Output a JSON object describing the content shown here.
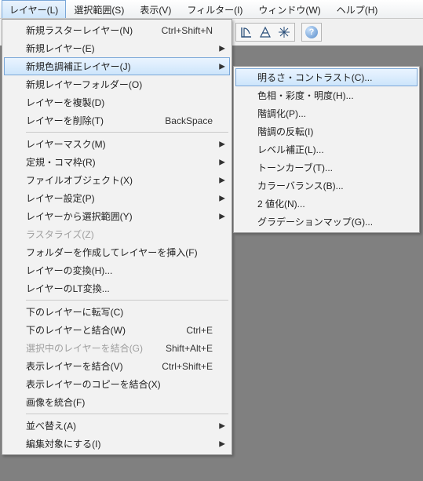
{
  "menubar": {
    "items": [
      {
        "label": "レイヤー(L)"
      },
      {
        "label": "選択範囲(S)"
      },
      {
        "label": "表示(V)"
      },
      {
        "label": "フィルター(I)"
      },
      {
        "label": "ウィンドウ(W)"
      },
      {
        "label": "ヘルプ(H)"
      }
    ]
  },
  "help_label": "?",
  "menu_main": {
    "groups": [
      [
        {
          "label": "新規ラスターレイヤー(N)",
          "accel": "Ctrl+Shift+N"
        },
        {
          "label": "新規レイヤー(E)",
          "submenu": true
        },
        {
          "label": "新規色調補正レイヤー(J)",
          "submenu": true,
          "highlight": true
        },
        {
          "label": "新規レイヤーフォルダー(O)"
        },
        {
          "label": "レイヤーを複製(D)"
        },
        {
          "label": "レイヤーを削除(T)",
          "accel": "BackSpace"
        }
      ],
      [
        {
          "label": "レイヤーマスク(M)",
          "submenu": true
        },
        {
          "label": "定規・コマ枠(R)",
          "submenu": true
        },
        {
          "label": "ファイルオブジェクト(X)",
          "submenu": true
        },
        {
          "label": "レイヤー設定(P)",
          "submenu": true
        },
        {
          "label": "レイヤーから選択範囲(Y)",
          "submenu": true
        },
        {
          "label": "ラスタライズ(Z)",
          "disabled": true
        },
        {
          "label": "フォルダーを作成してレイヤーを挿入(F)"
        },
        {
          "label": "レイヤーの変換(H)..."
        },
        {
          "label": "レイヤーのLT変換..."
        }
      ],
      [
        {
          "label": "下のレイヤーに転写(C)"
        },
        {
          "label": "下のレイヤーと結合(W)",
          "accel": "Ctrl+E"
        },
        {
          "label": "選択中のレイヤーを結合(G)",
          "accel": "Shift+Alt+E",
          "disabled": true
        },
        {
          "label": "表示レイヤーを結合(V)",
          "accel": "Ctrl+Shift+E"
        },
        {
          "label": "表示レイヤーのコピーを結合(X)"
        },
        {
          "label": "画像を統合(F)"
        }
      ],
      [
        {
          "label": "並べ替え(A)",
          "submenu": true
        },
        {
          "label": "編集対象にする(I)",
          "submenu": true
        }
      ]
    ]
  },
  "menu_sub": {
    "items": [
      {
        "label": "明るさ・コントラスト(C)...",
        "highlight": true
      },
      {
        "label": "色相・彩度・明度(H)..."
      },
      {
        "label": "階調化(P)..."
      },
      {
        "label": "階調の反転(I)"
      },
      {
        "label": "レベル補正(L)..."
      },
      {
        "label": "トーンカーブ(T)..."
      },
      {
        "label": "カラーバランス(B)..."
      },
      {
        "label": "2 値化(N)..."
      },
      {
        "label": "グラデーションマップ(G)..."
      }
    ]
  }
}
